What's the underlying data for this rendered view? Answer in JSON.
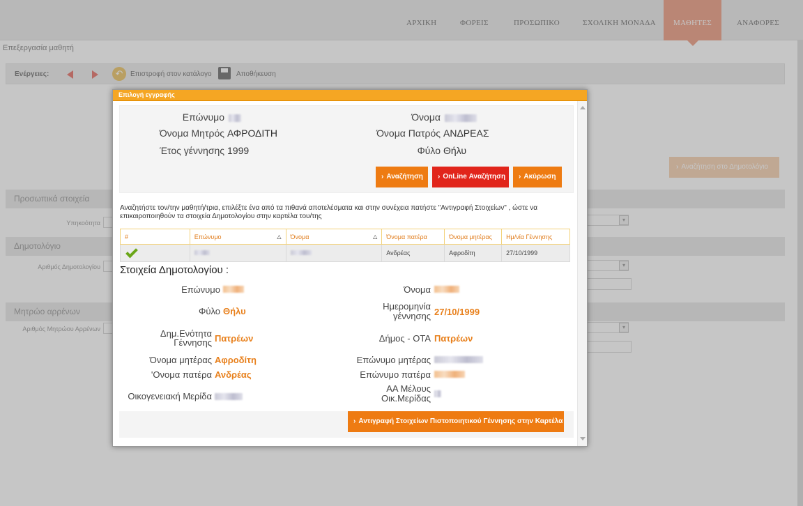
{
  "nav": {
    "items": [
      {
        "label": "ΑΡΧΙΚΗ"
      },
      {
        "label": "ΦΟΡΕΙΣ"
      },
      {
        "label": "ΠΡΟΣΩΠΙΚΟ"
      },
      {
        "label": "ΣΧΟΛΙΚΗ ΜΟΝΑΔΑ"
      },
      {
        "label": "ΜΑΘΗΤΕΣ"
      },
      {
        "label": "ΑΝΑΦΟΡΕΣ"
      }
    ],
    "active": "ΜΑΘΗΤΕΣ"
  },
  "page": {
    "breadcrumb": "Επεξεργασία μαθητή",
    "actions_label": "Ενέργειες:",
    "return_label": "Επιστροφή στον κατάλογο",
    "save_label": "Αποθήκευση",
    "search_registry_button": "Αναζήτηση στο Δημοτολόγιο",
    "sections": {
      "personal": "Προσωπικά στοιχεία",
      "registry": "Δημοτολόγιο",
      "males": "Μητρώο αρρένων"
    },
    "fields": {
      "citizenship": "Υπηκοότητα",
      "registry_number": "Αριθμός Δημοτολογίου",
      "males_number": "Αριθμός Μητρώου Αρρένων"
    }
  },
  "modal": {
    "title": "Επιλογή εγγραφής",
    "search": {
      "surname_label": "Επώνυμο",
      "name_label": "Όνομα",
      "mother_label": "Όνομα Μητρός",
      "mother_value": "ΑΦΡΟΔΙΤΗ",
      "father_label": "Όνομα Πατρός",
      "father_value": "ΑΝΔΡΕΑΣ",
      "birth_year_label": "Έτος γέννησης",
      "birth_year_value": "1999",
      "gender_label": "Φύλο",
      "gender_value": "Θήλυ",
      "search_button": "Αναζήτηση",
      "online_button": "OnLine Αναζήτηση",
      "cancel_button": "Ακύρωση"
    },
    "instructions": "Αναζητήστε τον/την μαθητή/τρια, επιλέξτε ένα από τα πιθανά αποτελέσματα και στην συνέχεια πατήστε \"Αντιγραφή Στοιχείων\" , ώστε να επικαιροποιηθούν τα στοιχεία Δημοτολογίου στην καρτέλα του/της",
    "table": {
      "columns": [
        "#",
        "Επώνυμο",
        "Όνομα",
        "Όνομα πατέρα",
        "Όνομα μητέρας",
        "Ημ/νία Γέννησης"
      ],
      "rows": [
        {
          "father": "Ανδρέας",
          "mother": "Αφροδίτη",
          "birth_date": "27/10/1999"
        }
      ]
    },
    "registry": {
      "title": "Στοιχεία Δημοτολογίου :",
      "surname_label": "Επώνυμο",
      "name_label": "Όνομα",
      "gender_label": "Φύλο",
      "gender_value": "Θήλυ",
      "birth_date_label_1": "Ημερομηνία",
      "birth_date_label_2": "γέννησης",
      "birth_date_value": "27/10/1999",
      "unit_label_1": "Δημ.Ενότητα",
      "unit_label_2": "Γέννησης",
      "unit_value": "Πατρέων",
      "municipality_label": "Δήμος - ΟΤΑ",
      "municipality_value": "Πατρέων",
      "mother_name_label": "Όνομα μητέρας",
      "mother_name_value": "Αφροδίτη",
      "mother_surname_label": "Επώνυμο μητέρας",
      "father_name_label": "'Ονομα πατέρα",
      "father_name_value": "Ανδρέας",
      "father_surname_label": "Επώνυμο πατέρα",
      "family_share_label": "Οικογενειακή Μερίδα",
      "member_label_1": "ΑΑ Μέλους",
      "member_label_2": "Οικ.Μερίδας"
    },
    "copy_button": "Αντιγραφή Στοιχείων Πιστοποιητικού Γέννησης στην Καρτέλα"
  },
  "colors": {
    "accent_orange": "#ee7b12",
    "danger_red": "#e1251b",
    "modal_header": "#f5a623",
    "nav_active": "#e98a6c"
  }
}
